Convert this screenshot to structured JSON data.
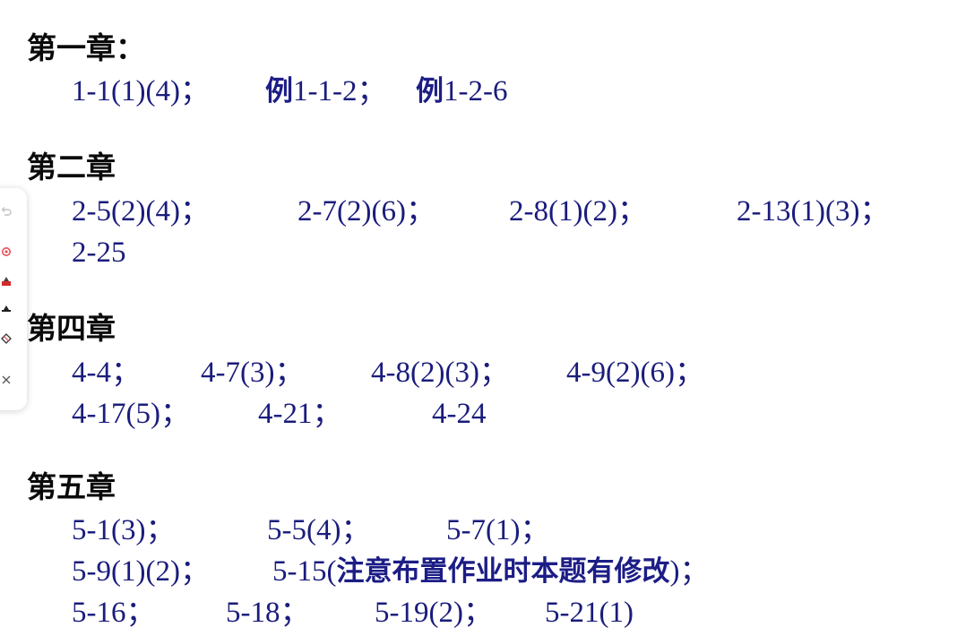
{
  "chapters": [
    {
      "heading": "第一章：",
      "items": [
        {
          "text": "1-1(1)(4)；"
        },
        {
          "label": "例",
          "text": "1-1-2；"
        },
        {
          "label": "例",
          "text": "1-2-6"
        }
      ]
    },
    {
      "heading": "第二章",
      "items": [
        {
          "text": "2-5(2)(4)；"
        },
        {
          "text": "2-7(2)(6)；"
        },
        {
          "text": "2-8(1)(2)；"
        },
        {
          "text": "2-13(1)(3)；"
        },
        {
          "text": "2-25"
        }
      ]
    },
    {
      "heading": "第四章",
      "items": [
        {
          "text": "4-4；"
        },
        {
          "text": "4-7(3)；"
        },
        {
          "text": "4-8(2)(3)；"
        },
        {
          "text": "4-9(2)(6)；"
        },
        {
          "text": "4-17(5)；"
        },
        {
          "text": "4-21；"
        },
        {
          "text": "4-24"
        }
      ]
    },
    {
      "heading": "第五章",
      "items": [
        {
          "text": "5-1(3)；"
        },
        {
          "text": "5-5(4)；"
        },
        {
          "text": "5-7(1)；"
        },
        {
          "text": "5-9(1)(2)；"
        },
        {
          "text": "5-15(",
          "note": "注意布置作业时本题有修改",
          "suffix": ")；"
        },
        {
          "text": "5-16；"
        },
        {
          "text": "5-18；"
        },
        {
          "text": "5-19(2)；"
        },
        {
          "text": "5-21(1)"
        }
      ]
    }
  ],
  "toolbar": {
    "tools": [
      {
        "icon": "undo-icon"
      },
      {
        "icon": "record-icon",
        "color": "#e8505b"
      },
      {
        "icon": "highlighter-red-icon",
        "color": "#d42a2a"
      },
      {
        "icon": "highlighter-black-icon",
        "color": "#222222"
      },
      {
        "icon": "eraser-icon"
      },
      {
        "icon": "close-icon"
      }
    ]
  }
}
